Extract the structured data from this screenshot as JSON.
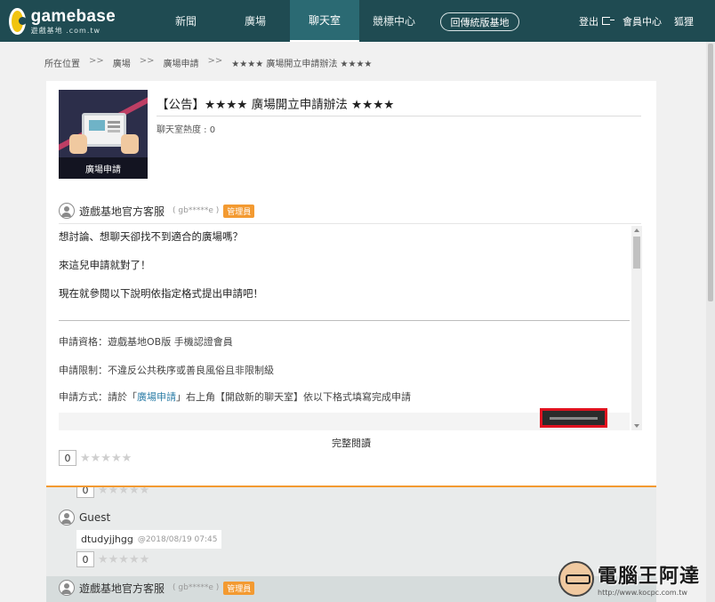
{
  "header": {
    "logo_word": "gamebase",
    "logo_sub": "遊戲基地 .com.tw",
    "nav": [
      "新聞",
      "廣場",
      "聊天室",
      "競標中心"
    ],
    "active_nav": 2,
    "classic_button": "回傳統版基地",
    "logout": "登出",
    "member_center": "會員中心",
    "user": "狐狸"
  },
  "breadcrumb": [
    "所在位置",
    "廣場",
    "廣場申請",
    "★★★★ 廣場開立申請辦法 ★★★★"
  ],
  "post": {
    "thumb_label": "廣場申請",
    "title": "【公告】★★★★ 廣場開立申請辦法 ★★★★",
    "heat": "聊天室熱度 : 0",
    "author": "遊戲基地官方客服",
    "author_id": "( gb*****e )",
    "badge": "管理員",
    "lines": [
      "想討論、想聊天卻找不到適合的廣場嗎？",
      "來這兒申請就對了！",
      "現在就參閱以下說明依指定格式提出申請吧！"
    ],
    "qualification": "申請資格：遊戲基地OB版 手機認證會員",
    "restriction": "申請限制：不違反公共秩序或善良風俗且非限制級",
    "method_prefix": "申請方式：請於「",
    "method_link": "廣場申請",
    "method_suffix": "」右上角【開啟新的聊天室】依以下格式填寫完成申請",
    "read_all": "完整閱讀",
    "count": "0",
    "stars": "★★★★★"
  },
  "comments": {
    "top_count": "0",
    "guest_name": "Guest",
    "guest_text": "dtudyjjhgg",
    "guest_time": "@2018/08/19 07:45",
    "guest_count": "0",
    "next_author": "遊戲基地官方客服",
    "next_author_id": "( gb*****e )",
    "next_badge": "管理員"
  },
  "watermark": {
    "title": "電腦王阿達",
    "url": "http://www.kocpc.com.tw"
  }
}
